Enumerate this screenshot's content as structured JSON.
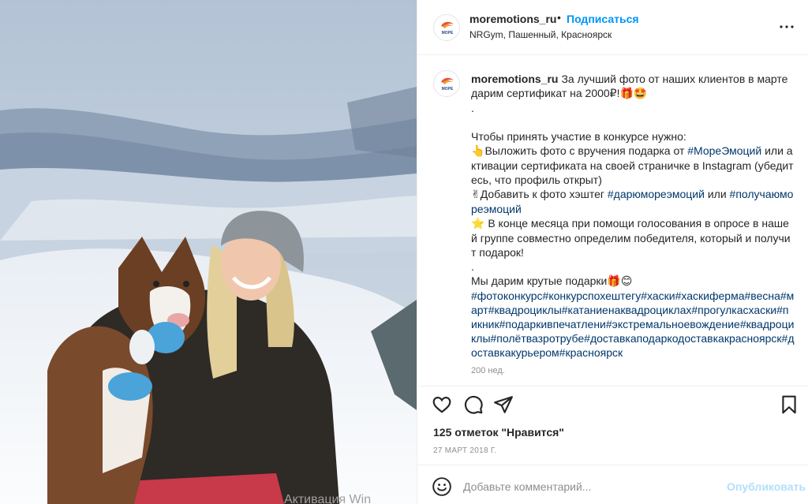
{
  "post": {
    "username": "moremotions_ru",
    "follow_label": "Подписаться",
    "location": "NRGym, Пашенный, Красноярск",
    "avatar_text": "МОРЕ"
  },
  "caption": {
    "username": "moremotions_ru",
    "intro": "За лучший фото от наших клиентов в марте дарим сертификат на 2000₽!",
    "dot1": ".",
    "rules_title": "Чтобы принять участие в конкурсе нужно:",
    "step1_a": "Выложить фото с вручения подарка от ",
    "step1_tag": "#МореЭмоций",
    "step1_b": " или активации сертификата на своей страничке в Instagram (убедитесь, что профиль открыт)",
    "step2_a": "Добавить к фото хэштег ",
    "step2_tag1": "#дарюмореэмоций",
    "step2_b": " или ",
    "step2_tag2": "#получаюмореэмоций",
    "step3": " В конце месяца при помощи голосования в опросе в нашей группе совместно определим победителя, который и получит подарок!",
    "dot2": ".",
    "gifts": "Мы дарим крутые подарки",
    "hashtags": [
      "#фотоконкурс",
      "#конкурспохештегу",
      "#хаски",
      "#хаскиферма",
      "#весна",
      "#март",
      "#квадроциклы",
      "#катаниенаквадроциклах",
      "#прогулкасхаски",
      "#пикник",
      "#подаркивпечатлени",
      "#экстремальноевождение",
      "#квадроциклы",
      "#полётвазротрубе",
      "#доставкаподаркодоставкакрасноярск",
      "#доставкакурьером",
      "#красноярск"
    ],
    "time_ago": "200 нед."
  },
  "icons": {
    "like": "heart-icon",
    "comment": "comment-icon",
    "share": "send-icon",
    "save": "bookmark-icon",
    "more": "more-dots-icon",
    "emoji": "smiley-icon"
  },
  "stats": {
    "likes": "125 отметок \"Нравится\"",
    "date": "27 МАРТ 2018 Г."
  },
  "comment": {
    "placeholder": "Добавьте комментарий...",
    "publish": "Опубликовать"
  },
  "overlay": {
    "watermark": "Активация Win"
  },
  "colors": {
    "link": "#0095f6",
    "hashtag": "#00376b",
    "muted": "#8e8e8e",
    "publish_disabled": "#b2dffc"
  }
}
